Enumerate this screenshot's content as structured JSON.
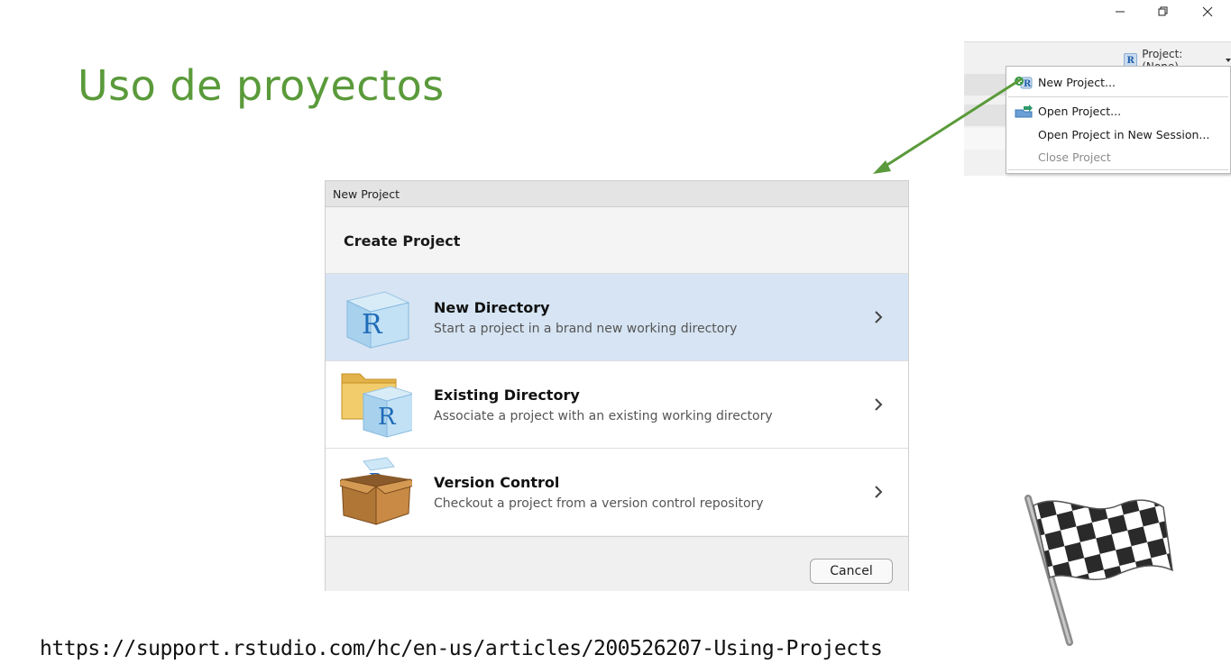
{
  "window_controls": {
    "minimize_glyph": "—",
    "restore_glyph": "❐",
    "close_glyph": "✕"
  },
  "slide": {
    "title": "Uso de proyectos",
    "url": "https://support.rstudio.com/hc/en-us/articles/200526207-Using-Projects",
    "title_color": "#5a9a3a"
  },
  "rstudio": {
    "project_label": "Project: (None)",
    "project_icon_letter": "R",
    "menu": {
      "items": [
        {
          "label": "New Project...",
          "icon": "new-project-icon",
          "enabled": true
        },
        {
          "label": "Open Project...",
          "icon": "open-project-icon",
          "enabled": true
        },
        {
          "label": "Open Project in New Session...",
          "icon": "",
          "enabled": true
        },
        {
          "label": "Close Project",
          "icon": "",
          "enabled": false
        }
      ]
    }
  },
  "dialog": {
    "window_title": "New Project",
    "heading": "Create Project",
    "options": [
      {
        "title": "New Directory",
        "description": "Start a project in a brand new working directory",
        "icon": "r-cube-icon",
        "selected": true
      },
      {
        "title": "Existing Directory",
        "description": "Associate a project with an existing working directory",
        "icon": "folder-r-icon",
        "selected": false
      },
      {
        "title": "Version Control",
        "description": "Checkout a project from a version control repository",
        "icon": "box-icon",
        "selected": false
      }
    ],
    "cancel_label": "Cancel",
    "selected_color": "#d6e4f3"
  },
  "decorations": {
    "arrow_color": "#5a9a3a",
    "flag_icon": "checkered-flag-icon"
  }
}
